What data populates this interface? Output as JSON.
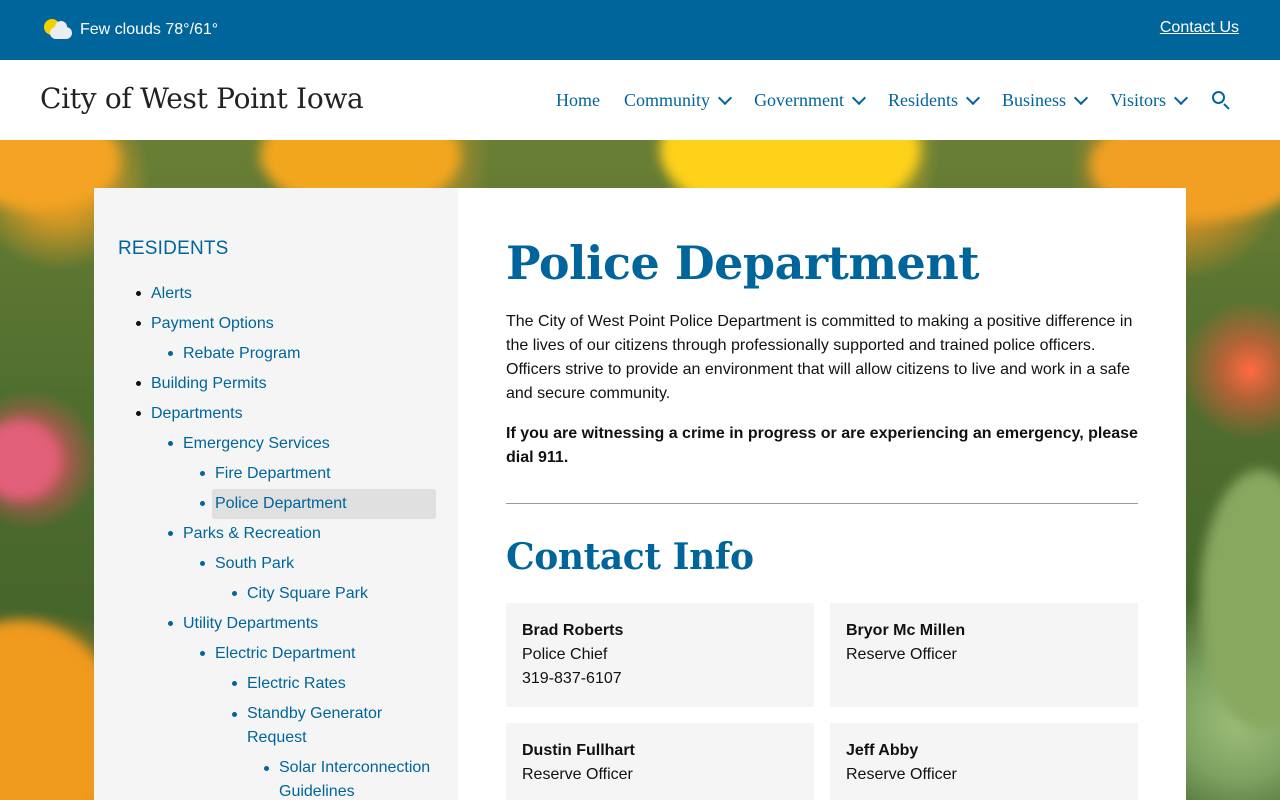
{
  "topbar": {
    "weather": "Few clouds 78°/61°",
    "contact_label": "Contact Us"
  },
  "header": {
    "site_title": "City of West Point Iowa",
    "nav": [
      {
        "label": "Home",
        "dropdown": false
      },
      {
        "label": "Community",
        "dropdown": true
      },
      {
        "label": "Government",
        "dropdown": true
      },
      {
        "label": "Residents",
        "dropdown": true
      },
      {
        "label": "Business",
        "dropdown": true
      },
      {
        "label": "Visitors",
        "dropdown": true
      }
    ]
  },
  "sidebar": {
    "title": "RESIDENTS",
    "items": [
      {
        "label": "Alerts"
      },
      {
        "label": "Payment Options"
      },
      {
        "label": "Rebate Program"
      },
      {
        "label": "Building Permits"
      },
      {
        "label": "Departments"
      },
      {
        "label": "Emergency Services"
      },
      {
        "label": "Fire Department"
      },
      {
        "label": "Police Department",
        "active": true
      },
      {
        "label": "Parks & Recreation"
      },
      {
        "label": "South Park"
      },
      {
        "label": "City Square Park"
      },
      {
        "label": "Utility Departments"
      },
      {
        "label": "Electric Department"
      },
      {
        "label": "Electric Rates"
      },
      {
        "label": "Standby Generator Request"
      },
      {
        "label": "Solar Interconnection Guidelines"
      }
    ]
  },
  "main": {
    "title": "Police Department",
    "intro": "The City of West Point Police Department is committed to making a positive difference in the lives of our citizens through professionally supported and trained police officers. Officers strive to provide an environment that will allow citizens to live and work in a safe and secure community.",
    "emergency": "If you are witnessing a crime in progress or are experiencing an emergency, please dial 911.",
    "contact_title": "Contact Info",
    "contacts": [
      {
        "name": "Brad Roberts",
        "role": "Police Chief",
        "phone": "319-837-6107"
      },
      {
        "name": "Bryor Mc Millen",
        "role": "Reserve Officer",
        "phone": ""
      },
      {
        "name": "Dustin Fullhart",
        "role": "Reserve Officer",
        "phone": ""
      },
      {
        "name": "Jeff Abby",
        "role": "Reserve Officer",
        "phone": ""
      }
    ]
  },
  "colors": {
    "brand": "#00659a",
    "sidebar_bg": "#f5f5f5",
    "active_bg": "#e0e0e0"
  },
  "icons": [
    "weather-partly-cloudy-icon",
    "chevron-down-icon",
    "search-icon"
  ]
}
